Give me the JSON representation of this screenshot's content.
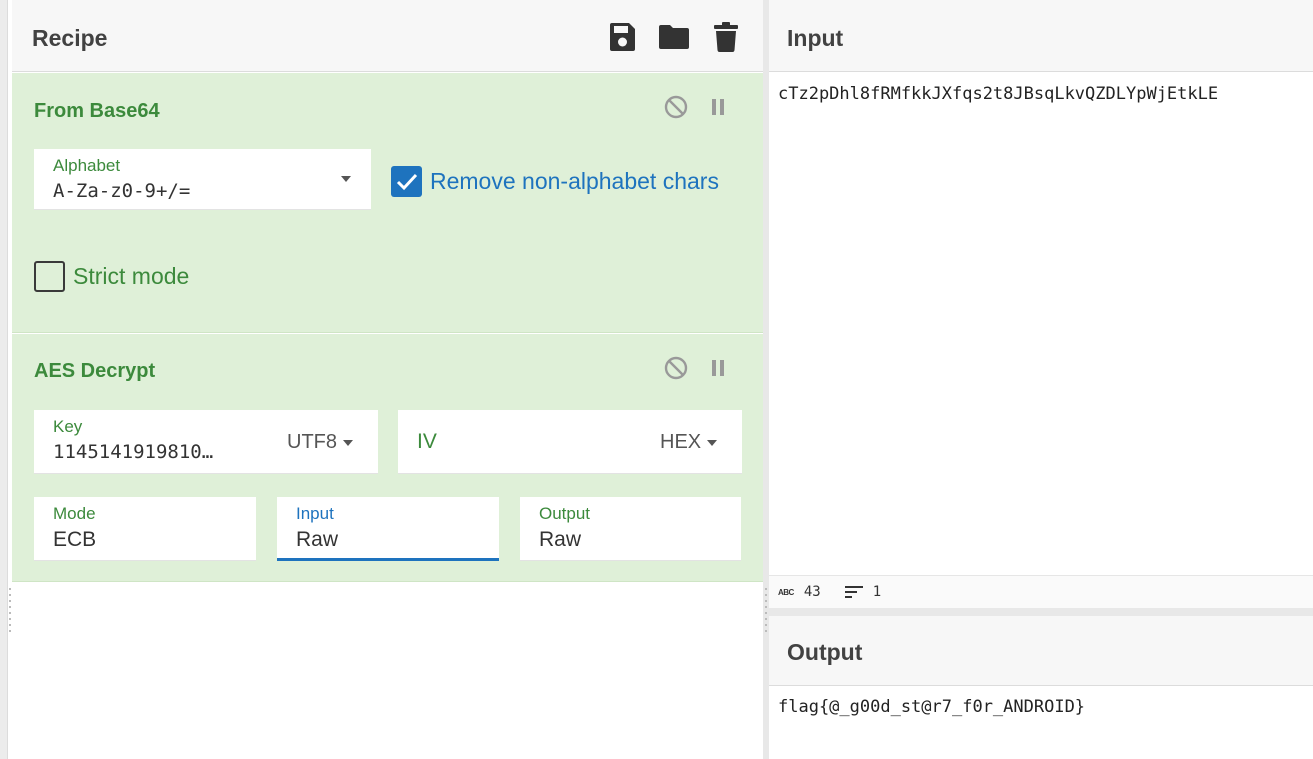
{
  "recipe": {
    "title": "Recipe",
    "header_icons": [
      "save-icon",
      "folder-icon",
      "trash-icon"
    ]
  },
  "operations": [
    {
      "title": "From Base64",
      "alphabet": {
        "label": "Alphabet",
        "value": "A-Za-z0-9+/="
      },
      "remove_non_alphabet": {
        "label": "Remove non-alphabet chars",
        "checked": true
      },
      "strict_mode": {
        "label": "Strict mode",
        "checked": false
      }
    },
    {
      "title": "AES Decrypt",
      "key": {
        "label": "Key",
        "value": "1145141919810…",
        "encoding": "UTF8"
      },
      "iv": {
        "label": "IV",
        "value": "",
        "encoding": "HEX"
      },
      "mode": {
        "label": "Mode",
        "value": "ECB"
      },
      "input": {
        "label": "Input",
        "value": "Raw"
      },
      "output": {
        "label": "Output",
        "value": "Raw"
      }
    }
  ],
  "input": {
    "title": "Input",
    "text": "cTz2pDhl8fRMfkkJXfqs2t8JBsqLkvQZDLYpWjEtkLE",
    "char_count": "43",
    "line_count": "1"
  },
  "output": {
    "title": "Output",
    "text": "flag{@_g00d_st@r7_f0r_ANDROID}"
  },
  "colors": {
    "operation_bg": "#dff0d8",
    "operation_title": "#3c8a3c",
    "accent_blue": "#1e73be"
  }
}
